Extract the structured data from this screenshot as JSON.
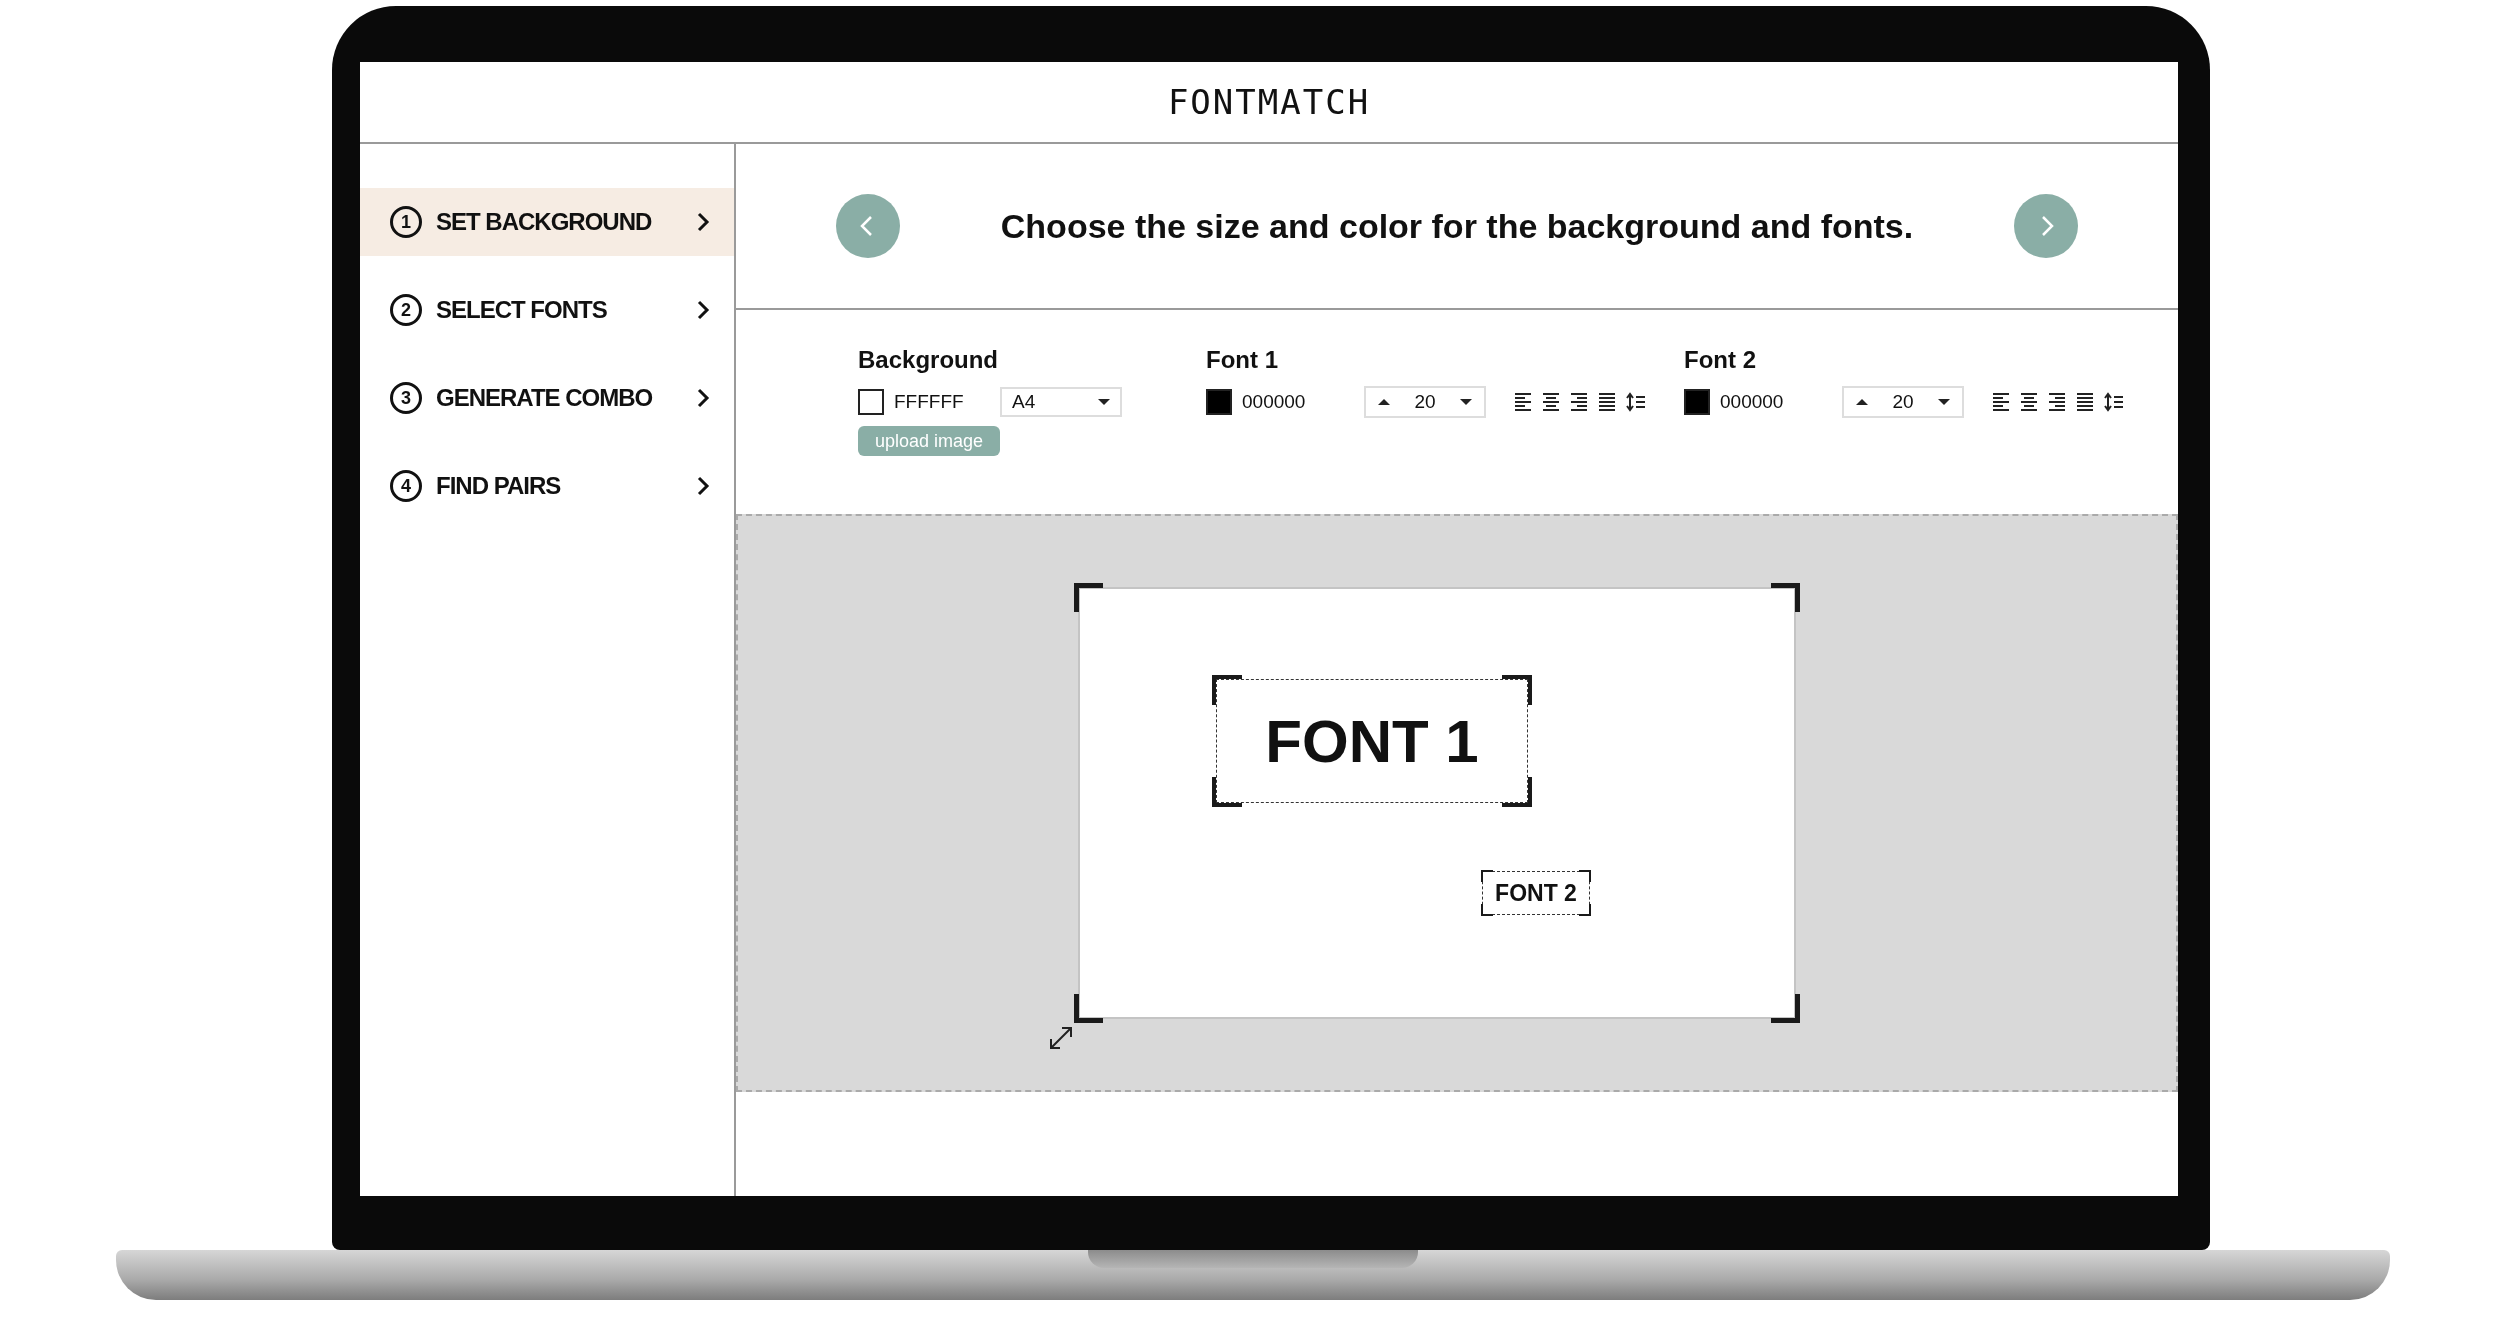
{
  "app": {
    "title": "FONTMATCH"
  },
  "steps": [
    {
      "number": "1",
      "label": "SET BACKGROUND",
      "selected": true
    },
    {
      "number": "2",
      "label": "SELECT FONTS",
      "selected": false
    },
    {
      "number": "3",
      "label": "GENERATE COMBO",
      "selected": false
    },
    {
      "number": "4",
      "label": "FIND PAIRS",
      "selected": false
    }
  ],
  "instruction": {
    "text": "Choose the size and color for the background and fonts."
  },
  "controls": {
    "background": {
      "label": "Background",
      "color": "#ffffff",
      "hex": "FFFFFF",
      "paper_size": "A4",
      "upload_button": "upload image"
    },
    "fonts": [
      {
        "label": "Font 1",
        "color": "#000000",
        "hex": "000000",
        "size": "20"
      },
      {
        "label": "Font 2",
        "color": "#000000",
        "hex": "000000",
        "size": "20"
      }
    ]
  },
  "canvas": {
    "items": [
      {
        "text": "FONT 1",
        "kind": "large"
      },
      {
        "text": "FONT 2",
        "kind": "small"
      }
    ]
  }
}
